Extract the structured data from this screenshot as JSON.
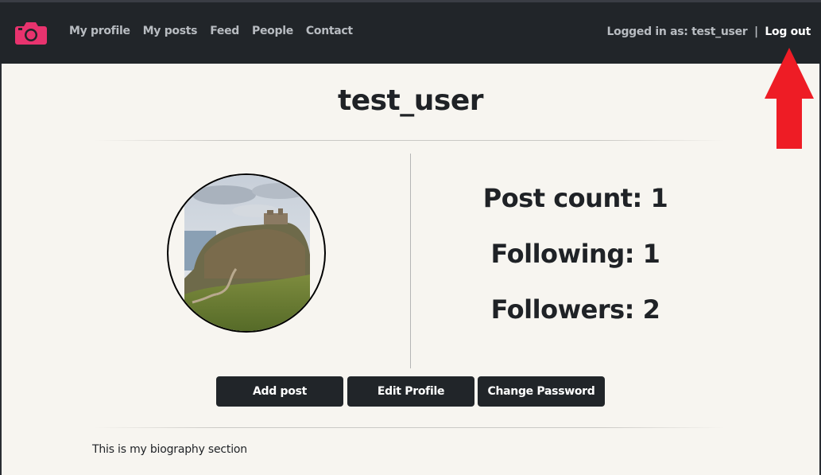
{
  "navbar": {
    "links": [
      {
        "label": "My profile"
      },
      {
        "label": "My posts"
      },
      {
        "label": "Feed"
      },
      {
        "label": "People"
      },
      {
        "label": "Contact"
      }
    ],
    "logged_in_text": "Logged in as: test_user",
    "separator": "|",
    "logout_label": "Log out",
    "logo_icon": "camera-icon",
    "brand_color": "#e8336e"
  },
  "profile": {
    "username": "test_user",
    "avatar_icon": "castle-photo",
    "stats": {
      "post_count": "Post count: 1",
      "following": "Following: 1",
      "followers": "Followers: 2"
    },
    "buttons": {
      "add_post": "Add post",
      "edit_profile": "Edit Profile",
      "change_password": "Change Password"
    },
    "bio": "This is my biography section"
  },
  "annotation": {
    "arrow_color": "#ee1c25",
    "arrow_icon": "up-arrow-annotation"
  }
}
